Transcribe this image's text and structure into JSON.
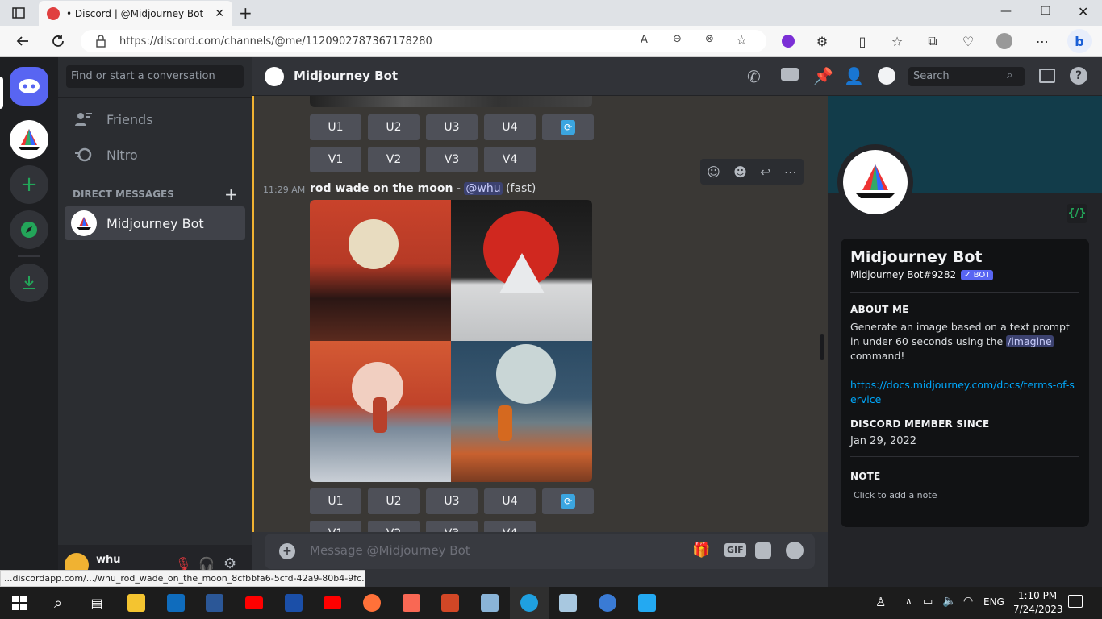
{
  "browser": {
    "tab_title": "• Discord | @Midjourney Bot",
    "url": "https://discord.com/channels/@me/1120902787367178280",
    "status_url": "...discordapp.com/.../whu_rod_wade_on_the_moon_8cfbbfa6-5cfd-42a9-80b4-9fc..."
  },
  "dm_column": {
    "search_placeholder": "Find or start a conversation",
    "friends_label": "Friends",
    "nitro_label": "Nitro",
    "direct_messages_header": "DIRECT MESSAGES",
    "dm_name": "Midjourney Bot"
  },
  "user_panel": {
    "username": "whu"
  },
  "chat_header": {
    "title": "Midjourney Bot",
    "search_placeholder": "Search"
  },
  "message": {
    "time": "11:29 AM",
    "prompt": "rod wade on the moon",
    "separator": " - ",
    "mention": "@whu",
    "mode": "(fast)"
  },
  "buttons": {
    "upscale": [
      "U1",
      "U2",
      "U3",
      "U4"
    ],
    "variation": [
      "V1",
      "V2",
      "V3",
      "V4"
    ]
  },
  "composer": {
    "placeholder": "Message @Midjourney Bot",
    "gif_label": "GIF"
  },
  "profile": {
    "name": "Midjourney Bot",
    "tag": "Midjourney Bot#9282",
    "bot_badge": "✓ BOT",
    "about_header": "ABOUT ME",
    "about_text_1": "Generate an image based on a text prompt in under 60 seconds using the ",
    "about_command": "/imagine",
    "about_text_2": " command!",
    "link": "https://docs.midjourney.com/docs/terms-of-service",
    "member_since_header": "DISCORD MEMBER SINCE",
    "member_since": "Jan 29, 2022",
    "note_header": "NOTE",
    "note_placeholder": "Click to add a note"
  },
  "taskbar": {
    "language": "ENG",
    "time": "1:10 PM",
    "date": "7/24/2023"
  },
  "colors": {
    "blurple": "#5865f2",
    "green": "#23a559",
    "bot_badge": "#5865f2",
    "link": "#00a8fc"
  }
}
